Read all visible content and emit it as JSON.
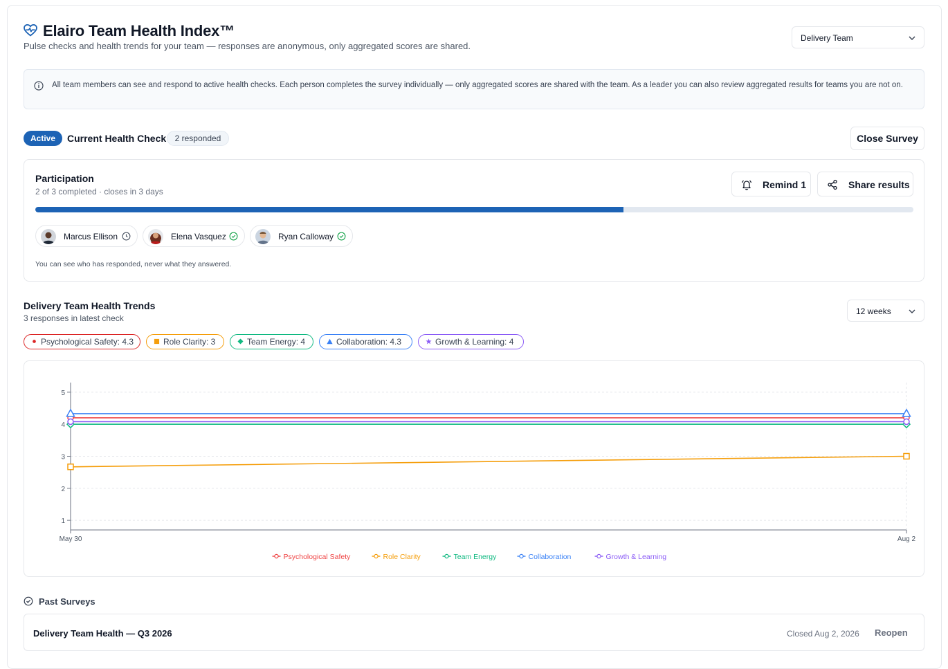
{
  "header": {
    "title": "Elairo Team Health Index™",
    "subtitle": "Pulse checks and health trends for your team — responses are anonymous, only aggregated scores are shared.",
    "team_select": "Delivery Team"
  },
  "info": {
    "text": "All team members can see and respond to active health checks. Each person completes the survey individually — only aggregated scores are shared with the team. As a leader you can also review aggregated results for teams you are not on."
  },
  "current_check": {
    "status_badge": "Active",
    "title": "Current Health Check",
    "responded_badge": "2 responded",
    "close_button": "Close Survey"
  },
  "participation": {
    "title": "Participation",
    "subtitle": "2 of 3 completed · closes in 3 days",
    "remind_button": "Remind 1",
    "share_button": "Share results",
    "progress_fraction": 0.67,
    "members": [
      {
        "name": "Marcus Ellison",
        "status": "pending"
      },
      {
        "name": "Elena Vasquez",
        "status": "completed"
      },
      {
        "name": "Ryan Calloway",
        "status": "completed"
      }
    ],
    "note": "You can see who has responded, never what they answered."
  },
  "trends": {
    "title": "Delivery Team Health Trends",
    "subtitle": "3 responses in latest check",
    "range_select": "12 weeks",
    "pills": [
      {
        "label": "Psychological Safety: 4.3",
        "color": "#dc2626",
        "marker": "circle"
      },
      {
        "label": "Role Clarity: 3",
        "color": "#f59e0b",
        "marker": "square"
      },
      {
        "label": "Team Energy: 4",
        "color": "#10b981",
        "marker": "diamond"
      },
      {
        "label": "Collaboration: 4.3",
        "color": "#3b82f6",
        "marker": "triangle"
      },
      {
        "label": "Growth & Learning: 4",
        "color": "#8b5cf6",
        "marker": "star"
      }
    ]
  },
  "chart_data": {
    "type": "line",
    "x": [
      "May 30",
      "Aug 2"
    ],
    "ylim": [
      0.7,
      5.3
    ],
    "yticks": [
      1,
      2,
      3,
      4,
      5
    ],
    "grid": true,
    "legend_placement": "bottom-center",
    "series": [
      {
        "name": "Psychological Safety",
        "values": [
          4.2,
          4.2
        ],
        "color": "#ef4444",
        "marker": "circle"
      },
      {
        "name": "Role Clarity",
        "values": [
          2.67,
          3.0
        ],
        "color": "#f59e0b",
        "marker": "square"
      },
      {
        "name": "Team Energy",
        "values": [
          4.0,
          4.0
        ],
        "color": "#10b981",
        "marker": "diamond"
      },
      {
        "name": "Collaboration",
        "values": [
          4.33,
          4.33
        ],
        "color": "#3b82f6",
        "marker": "triangle"
      },
      {
        "name": "Growth & Learning",
        "values": [
          4.08,
          4.08
        ],
        "color": "#8b5cf6",
        "marker": "circle"
      }
    ]
  },
  "past_surveys": {
    "title": "Past Surveys",
    "items": [
      {
        "name": "Delivery Team Health — Q3 2026",
        "closed": "Closed Aug 2, 2026",
        "action": "Reopen"
      }
    ]
  }
}
